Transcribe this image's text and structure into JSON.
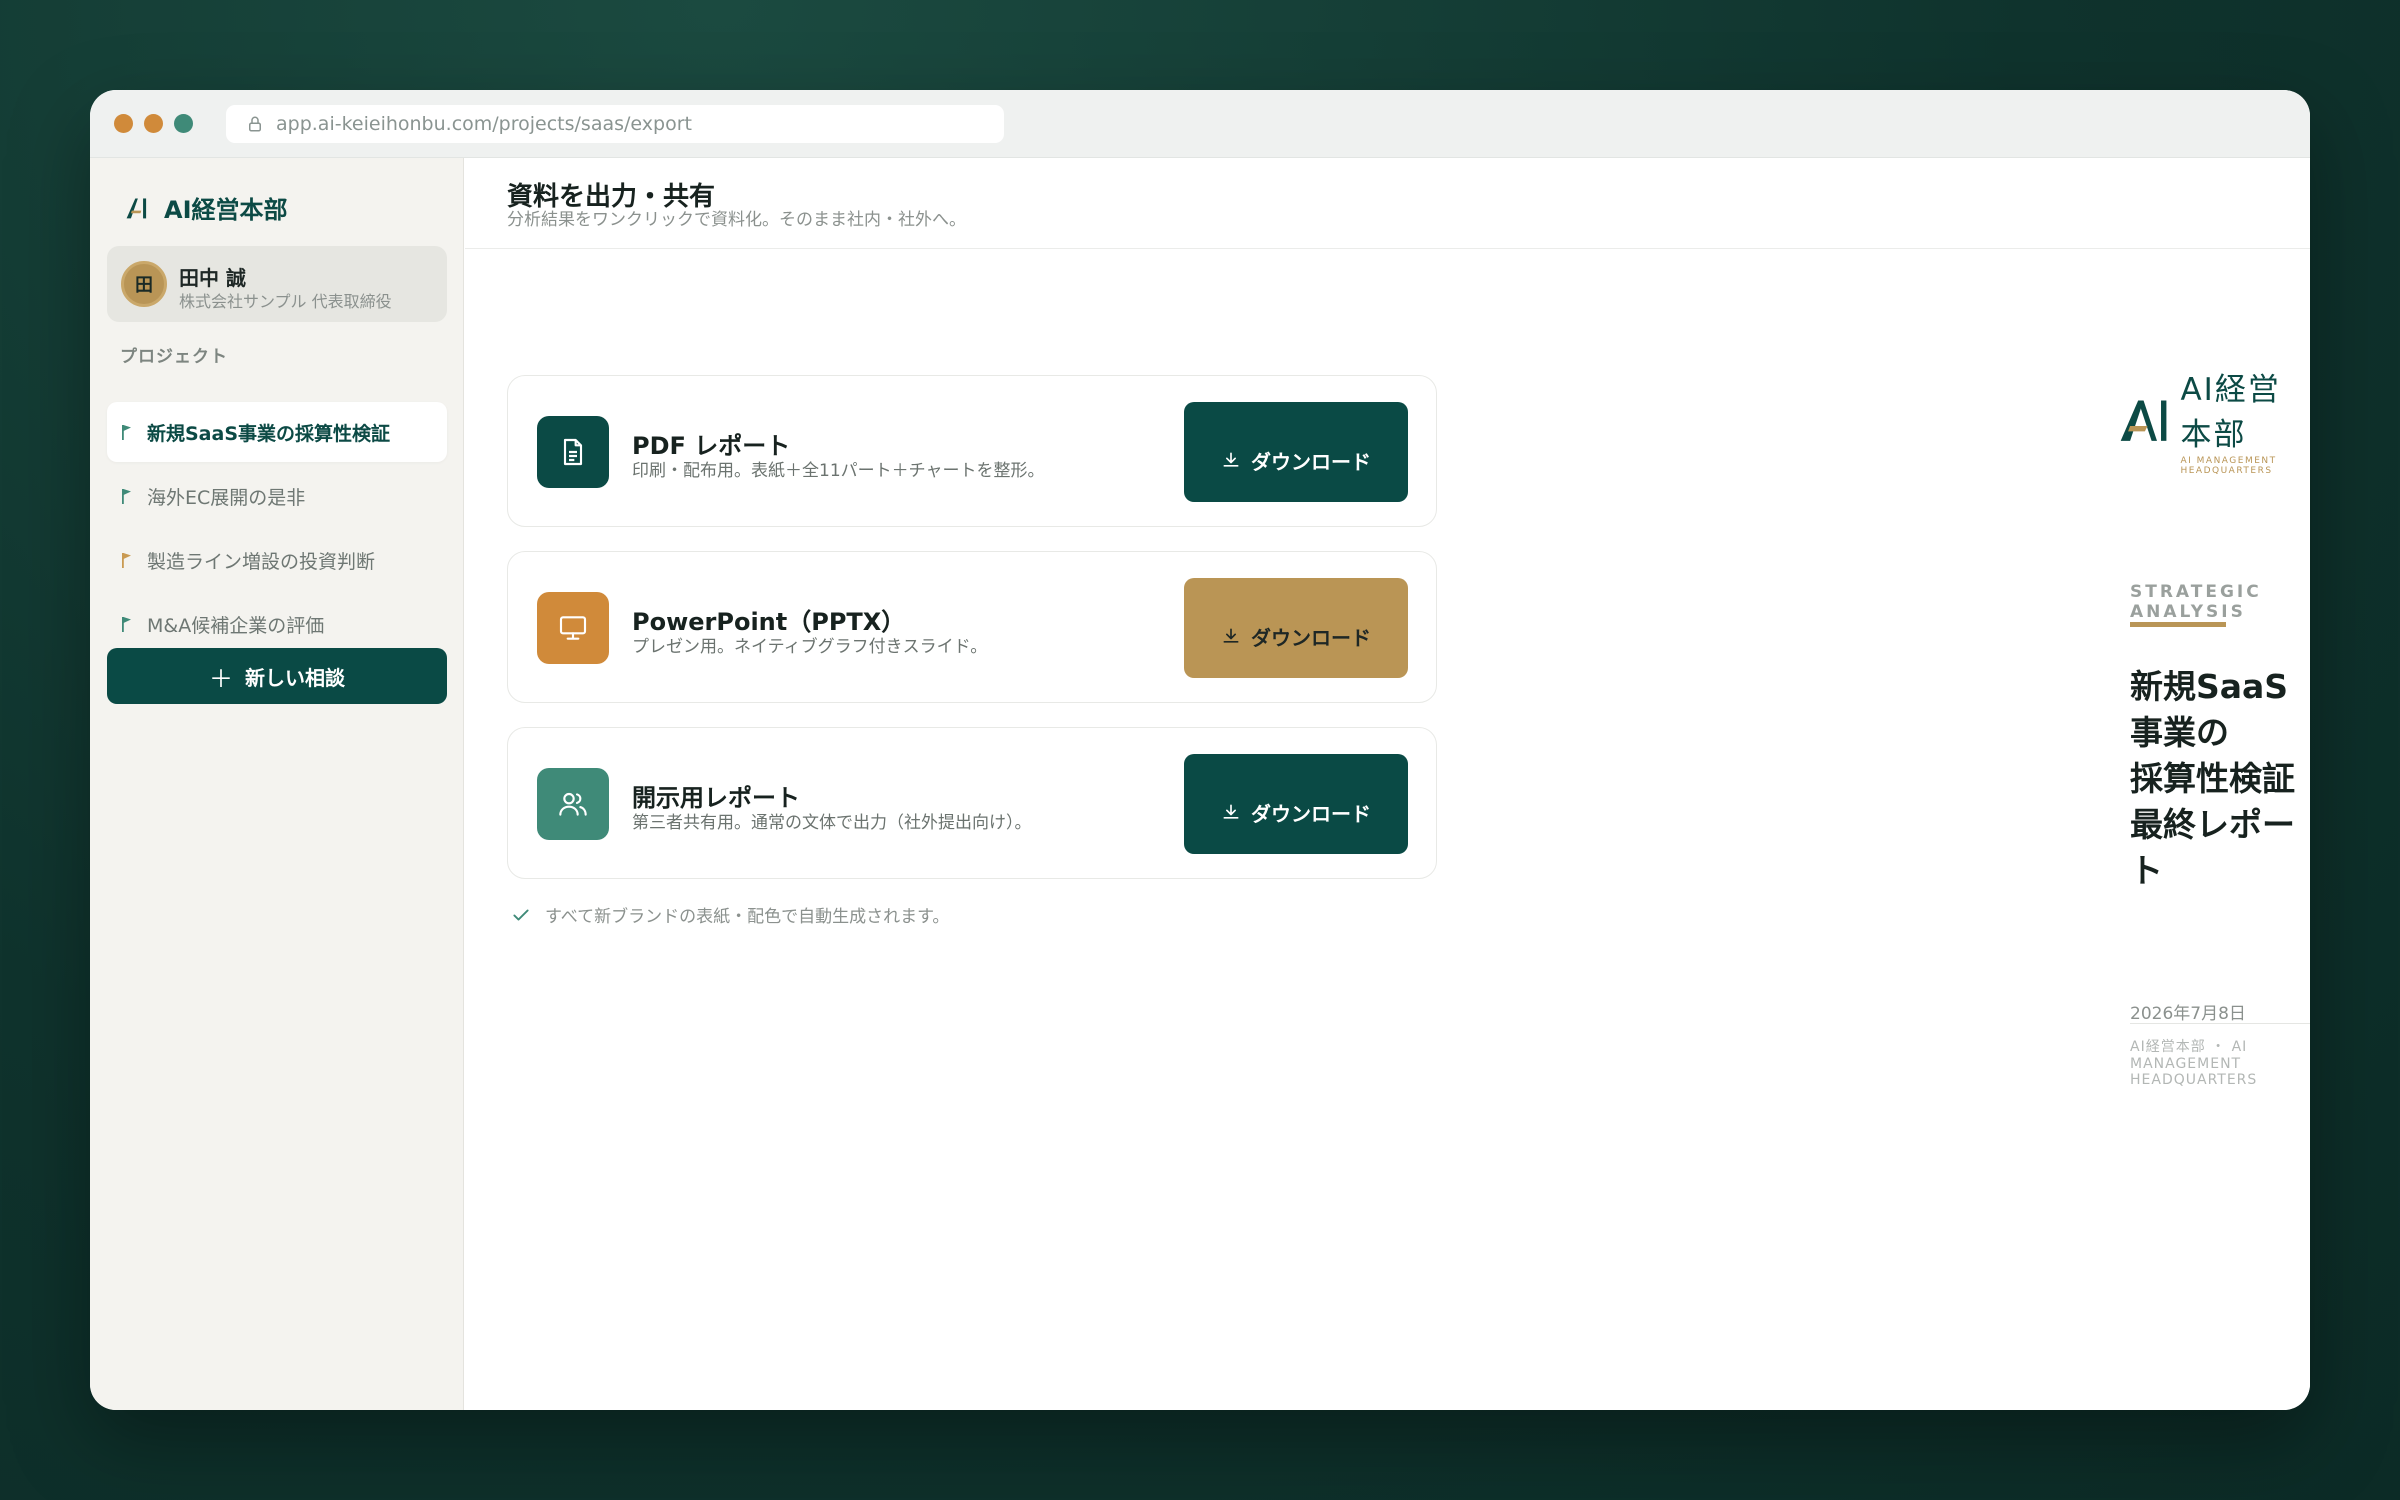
{
  "browser": {
    "url": "app.ai-keieihonbu.com/projects/saas/export",
    "dot_colors": [
      "#d08a3a",
      "#d08a3a",
      "#3f8a78"
    ]
  },
  "sidebar": {
    "brand_name": "AI経営本部",
    "user": {
      "initial": "田",
      "name": "田中 誠",
      "role": "株式会社サンプル 代表取締役"
    },
    "section_label": "プロジェクト",
    "projects": [
      {
        "label": "新規SaaS事業の採算性検証",
        "flag_color": "#3f8a78",
        "active": true
      },
      {
        "label": "海外EC展開の是非",
        "flag_color": "#3f8a78",
        "active": false
      },
      {
        "label": "製造ライン増設の投資判断",
        "flag_color": "#c99a52",
        "active": false
      },
      {
        "label": "M&A候補企業の評価",
        "flag_color": "#3f8a78",
        "active": false
      }
    ],
    "new_button": {
      "icon": "plus-icon",
      "label": "新しい相談"
    }
  },
  "main": {
    "title": "資料を出力・共有",
    "subtitle": "分析結果をワンクリックで資料化。そのまま社内・社外へ。",
    "exports": [
      {
        "icon": "document-icon",
        "icon_bg": "#0b4a45",
        "title": "PDF レポート",
        "desc": "印刷・配布用。表紙＋全11パート＋チャートを整形。",
        "button_label": "ダウンロード",
        "button_color": "#0a4a45"
      },
      {
        "icon": "monitor-icon",
        "icon_bg": "#d08a3a",
        "title": "PowerPoint（PPTX）",
        "desc": "プレゼン用。ネイティブグラフ付きスライド。",
        "button_label": "ダウンロード",
        "button_color": "#ba9555"
      },
      {
        "icon": "users-icon",
        "icon_bg": "#3f8a78",
        "title": "開示用レポート",
        "desc": "第三者共有用。通常の文体で出力（社外提出向け）。",
        "button_label": "ダウンロード",
        "button_color": "#0a4a45"
      }
    ],
    "note": "すべて新ブランドの表紙・配色で自動生成されます。"
  },
  "preview": {
    "logo_text": "AI経営本部",
    "logo_sub": "AI MANAGEMENT HEADQUARTERS",
    "eyebrow": "STRATEGIC ANALYSIS",
    "title_line1": "新規SaaS事業の",
    "title_line2": "採算性検証 最終レポート",
    "date": "2026年7月8日",
    "footer": "AI経営本部 ・ AI MANAGEMENT HEADQUARTERS"
  }
}
